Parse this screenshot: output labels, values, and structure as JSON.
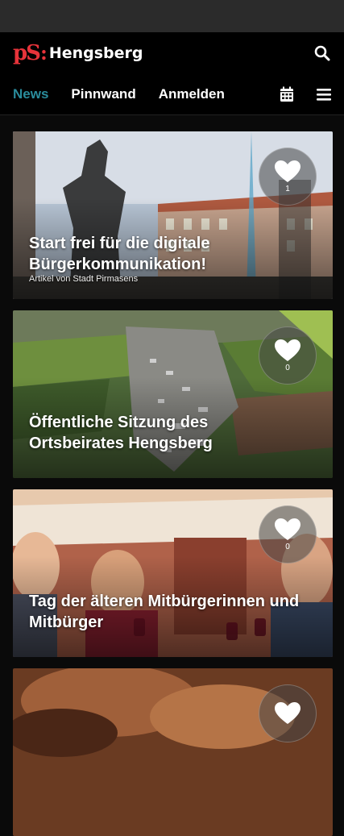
{
  "header": {
    "logo_mark": "pS",
    "brand_name": "Hengsberg"
  },
  "nav": {
    "tabs": [
      {
        "label": "News",
        "active": true
      },
      {
        "label": "Pinnwand",
        "active": false
      },
      {
        "label": "Anmelden",
        "active": false
      }
    ]
  },
  "colors": {
    "accent": "#2a8c9c",
    "brand_red": "#e6333a",
    "background": "#000000"
  },
  "icons": {
    "search": "search-icon",
    "calendar": "calendar-icon",
    "menu": "menu-icon",
    "like": "heart-icon"
  },
  "cards": [
    {
      "title": "Start frei für die digitale Bürgerkommunikation!",
      "subtitle": "Artikel von Stadt Pirmasens",
      "likes": "1"
    },
    {
      "title": "Öffentliche Sitzung des Ortsbeirates Hengsberg",
      "subtitle": "",
      "likes": "0"
    },
    {
      "title": "Tag der älteren Mitbürgerinnen und Mitbürger",
      "subtitle": "",
      "likes": "0"
    },
    {
      "title": "",
      "subtitle": "",
      "likes": ""
    }
  ]
}
